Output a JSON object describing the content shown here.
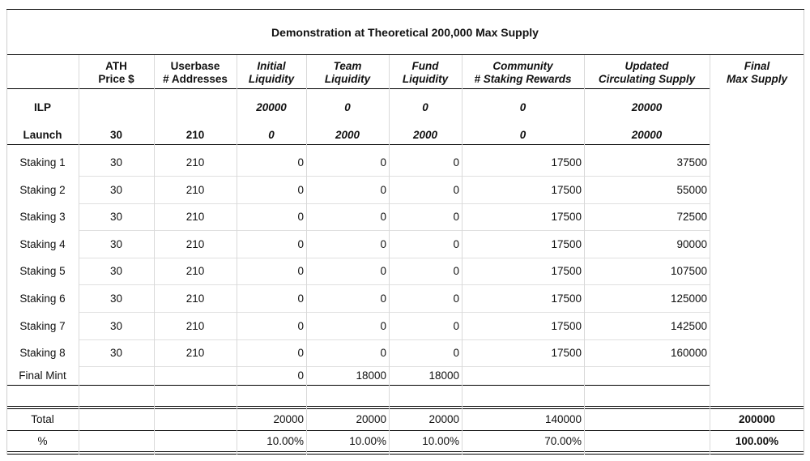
{
  "title": "Demonstration at Theoretical 200,000 Max Supply",
  "headers": [
    {
      "line1": "",
      "line2": ""
    },
    {
      "line1": "ATH",
      "line2": "Price $"
    },
    {
      "line1": "Userbase",
      "line2": "# Addresses"
    },
    {
      "line1": "Initial",
      "line2": "Liquidity"
    },
    {
      "line1": "Team",
      "line2": "Liquidity"
    },
    {
      "line1": "Fund",
      "line2": "Liquidity"
    },
    {
      "line1": "Community",
      "line2": "# Staking Rewards"
    },
    {
      "line1": "Updated",
      "line2": "Circulating Supply"
    },
    {
      "line1": "Final",
      "line2": "Max Supply"
    }
  ],
  "rows": [
    {
      "label": "ILP",
      "cells": [
        "",
        "",
        "20000",
        "0",
        "0",
        "0",
        "20000"
      ]
    },
    {
      "label": "Launch",
      "cells": [
        "30",
        "210",
        "0",
        "2000",
        "2000",
        "0",
        "20000"
      ]
    },
    {
      "label": "Staking 1",
      "cells": [
        "30",
        "210",
        "0",
        "0",
        "0",
        "17500",
        "37500"
      ]
    },
    {
      "label": "Staking 2",
      "cells": [
        "30",
        "210",
        "0",
        "0",
        "0",
        "17500",
        "55000"
      ]
    },
    {
      "label": "Staking 3",
      "cells": [
        "30",
        "210",
        "0",
        "0",
        "0",
        "17500",
        "72500"
      ]
    },
    {
      "label": "Staking 4",
      "cells": [
        "30",
        "210",
        "0",
        "0",
        "0",
        "17500",
        "90000"
      ]
    },
    {
      "label": "Staking 5",
      "cells": [
        "30",
        "210",
        "0",
        "0",
        "0",
        "17500",
        "107500"
      ]
    },
    {
      "label": "Staking 6",
      "cells": [
        "30",
        "210",
        "0",
        "0",
        "0",
        "17500",
        "125000"
      ]
    },
    {
      "label": "Staking 7",
      "cells": [
        "30",
        "210",
        "0",
        "0",
        "0",
        "17500",
        "142500"
      ]
    },
    {
      "label": "Staking 8",
      "cells": [
        "30",
        "210",
        "0",
        "0",
        "0",
        "17500",
        "160000"
      ]
    },
    {
      "label": "Final  Mint",
      "cells": [
        "",
        "",
        "0",
        "18000",
        "18000",
        "",
        ""
      ]
    }
  ],
  "total": {
    "label": "Total",
    "cells": [
      "",
      "",
      "20000",
      "20000",
      "20000",
      "140000",
      "",
      "200000"
    ]
  },
  "percent": {
    "label": "%",
    "cells": [
      "",
      "",
      "10.00%",
      "10.00%",
      "10.00%",
      "70.00%",
      "",
      "100.00%"
    ]
  }
}
